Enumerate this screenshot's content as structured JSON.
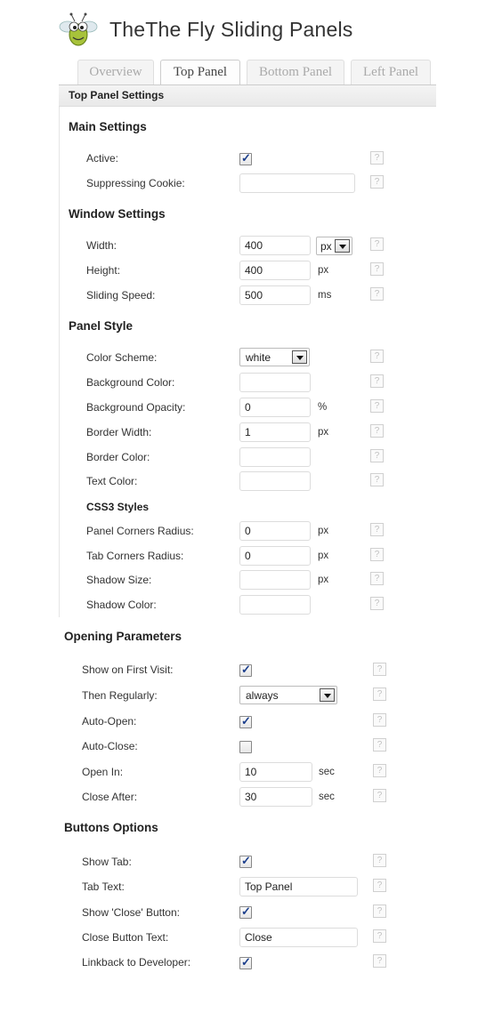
{
  "page": {
    "title": "TheThe Fly Sliding Panels",
    "logo": "fly-mascot-icon"
  },
  "tabs": [
    "Overview",
    "Top Panel",
    "Bottom Panel",
    "Left Panel"
  ],
  "active_tab": "Top Panel",
  "settings_header": "Top Panel Settings",
  "help_label": "?",
  "main_settings": {
    "title": "Main Settings",
    "active_label": "Active:",
    "active_checked": true,
    "cookie_label": "Suppressing Cookie:",
    "cookie_value": ""
  },
  "window_settings": {
    "title": "Window Settings",
    "width_label": "Width:",
    "width_value": "400",
    "width_unit": "px",
    "height_label": "Height:",
    "height_value": "400",
    "height_unit": "px",
    "speed_label": "Sliding Speed:",
    "speed_value": "500",
    "speed_unit": "ms"
  },
  "panel_style": {
    "title": "Panel Style",
    "scheme_label": "Color Scheme:",
    "scheme_value": "white",
    "bg_color_label": "Background Color:",
    "bg_color_value": "",
    "bg_opacity_label": "Background Opacity:",
    "bg_opacity_value": "0",
    "bg_opacity_unit": "%",
    "border_width_label": "Border Width:",
    "border_width_value": "1",
    "border_width_unit": "px",
    "border_color_label": "Border Color:",
    "border_color_value": "",
    "text_color_label": "Text Color:",
    "text_color_value": "",
    "css3_title": "CSS3 Styles",
    "panel_radius_label": "Panel Corners Radius:",
    "panel_radius_value": "0",
    "panel_radius_unit": "px",
    "tab_radius_label": "Tab Corners Radius:",
    "tab_radius_value": "0",
    "tab_radius_unit": "px",
    "shadow_size_label": "Shadow Size:",
    "shadow_size_value": "",
    "shadow_size_unit": "px",
    "shadow_color_label": "Shadow Color:",
    "shadow_color_value": ""
  },
  "opening_parameters": {
    "title": "Opening Parameters",
    "first_visit_label": "Show on First Visit:",
    "first_visit_checked": true,
    "regularly_label": "Then Regularly:",
    "regularly_value": "always",
    "auto_open_label": "Auto-Open:",
    "auto_open_checked": true,
    "auto_close_label": "Auto-Close:",
    "auto_close_checked": false,
    "open_in_label": "Open In:",
    "open_in_value": "10",
    "open_in_unit": "sec",
    "close_after_label": "Close After:",
    "close_after_value": "30",
    "close_after_unit": "sec"
  },
  "buttons_options": {
    "title": "Buttons Options",
    "show_tab_label": "Show Tab:",
    "show_tab_checked": true,
    "tab_text_label": "Tab Text:",
    "tab_text_value": "Top Panel",
    "show_close_label": "Show 'Close' Button:",
    "show_close_checked": true,
    "close_text_label": "Close Button Text:",
    "close_text_value": "Close",
    "linkback_label": "Linkback to Developer:",
    "linkback_checked": true
  }
}
